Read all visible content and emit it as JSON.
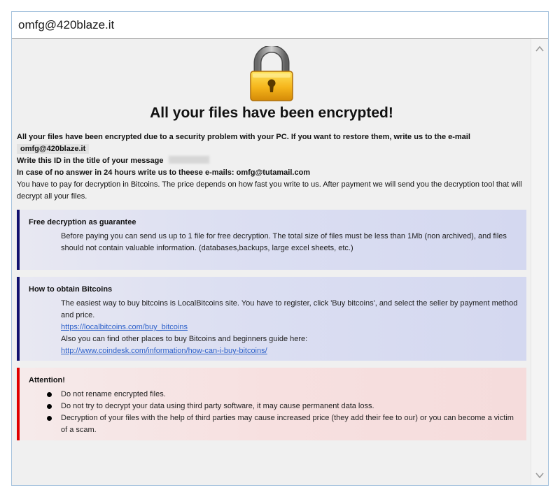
{
  "window": {
    "title": "omfg@420blaze.it"
  },
  "page": {
    "headline": "All your files have been encrypted!",
    "intro": {
      "line1_text": "All your files have been encrypted due to a security problem with your PC. If you want to restore them, write us to the e-mail",
      "line1_email": "omfg@420blaze.it",
      "line2_text": "Write this ID in the title of your message",
      "line3_text": "In case of no answer in 24 hours write us to theese e-mails:",
      "line3_email": "omfg@tutamail.com",
      "line4_text": "You have to pay for decryption in Bitcoins. The price depends on how fast you write to us. After payment we will send you the decryption tool that will decrypt all your files."
    },
    "free_decryption": {
      "title": "Free decryption as guarantee",
      "body": "Before paying you can send us up to 1 file for free decryption. The total size of files must be less than 1Mb (non archived), and files should not contain valuable information. (databases,backups, large excel sheets, etc.)"
    },
    "bitcoins": {
      "title": "How to obtain Bitcoins",
      "line1": "The easiest way to buy bitcoins is LocalBitcoins site. You have to register, click 'Buy bitcoins', and select the seller by payment method and price.",
      "link1": "https://localbitcoins.com/buy_bitcoins",
      "line2": "Also you can find other places to buy Bitcoins and beginners guide here:",
      "link2": "http://www.coindesk.com/information/how-can-i-buy-bitcoins/"
    },
    "attention": {
      "title": "Attention!",
      "items": [
        "Do not rename encrypted files.",
        "Do not try to decrypt your data using third party software, it may cause permanent data loss.",
        "Decryption of your files with the help of third parties may cause increased price (they add their fee to our) or you can become a victim of a scam."
      ]
    }
  },
  "icons": {
    "lock": "padlock-icon",
    "scroll_up": "chevron-up-icon",
    "scroll_down": "chevron-down-icon"
  },
  "colors": {
    "guarantee_accent": "#11116e",
    "attention_accent": "#e00000",
    "link": "#2b5fc9"
  }
}
